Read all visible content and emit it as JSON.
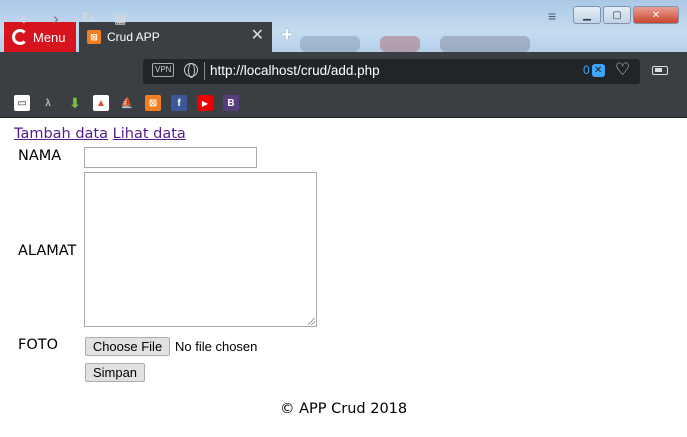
{
  "browser": {
    "menu_label": "Menu",
    "tab_title": "Crud APP",
    "vpn_label": "VPN",
    "url_prefix": "http://",
    "url_host": "localhost",
    "url_path": "/crud/add.php",
    "adblock_count": "0",
    "accent_color": "#d7141e"
  },
  "page": {
    "nav": {
      "add_link": "Tambah data",
      "view_link": "Lihat data"
    },
    "form": {
      "nama_label": "NAMA",
      "nama_value": "",
      "alamat_label": "ALAMAT",
      "alamat_value": "",
      "foto_label": "FOTO",
      "choose_file_label": "Choose File",
      "no_file_text": "No file chosen",
      "submit_label": "Simpan"
    },
    "footer": "© APP Crud 2018"
  }
}
